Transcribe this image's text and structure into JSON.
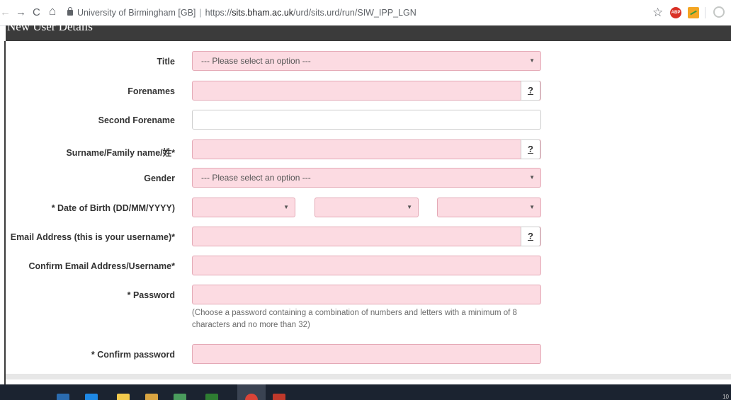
{
  "browser": {
    "nav_back": "←",
    "nav_forward": "→",
    "reload": "C",
    "home": "⌂",
    "site_name": "University of Birmingham [GB]",
    "url_prefix": "https://",
    "url_domain": "sits.bham.ac.uk",
    "url_path": "/urd/sits.urd/run/SIW_IPP_LGN",
    "star": "☆",
    "abp_label": "ABP"
  },
  "page": {
    "header_title": "New User Details"
  },
  "form": {
    "title": {
      "label": "Title",
      "value": "--- Please select an option ---",
      "caret": "▼"
    },
    "forenames": {
      "label": "Forenames",
      "help": "?"
    },
    "second_forename": {
      "label": "Second Forename"
    },
    "surname": {
      "label": "Surname/Family name/姓*",
      "help": "?"
    },
    "gender": {
      "label": "Gender",
      "value": "--- Please select an option ---",
      "caret": "▼"
    },
    "dob": {
      "label": "* Date of Birth (DD/MM/YYYY)",
      "caret": "▼"
    },
    "email": {
      "label": "Email Address (this is your username)*",
      "help": "?"
    },
    "confirm_email": {
      "label": "Confirm Email Address/Username*"
    },
    "password": {
      "label": "* Password",
      "hint": "(Choose a password containing a combination of numbers and letters with a minimum of 8 characters and no more than 32)"
    },
    "confirm_password": {
      "label": "* Confirm password"
    }
  },
  "taskbar": {
    "clock": "10"
  },
  "colors": {
    "required_field_bg": "#fcdbe2",
    "header_bg": "#3b3b3b"
  }
}
